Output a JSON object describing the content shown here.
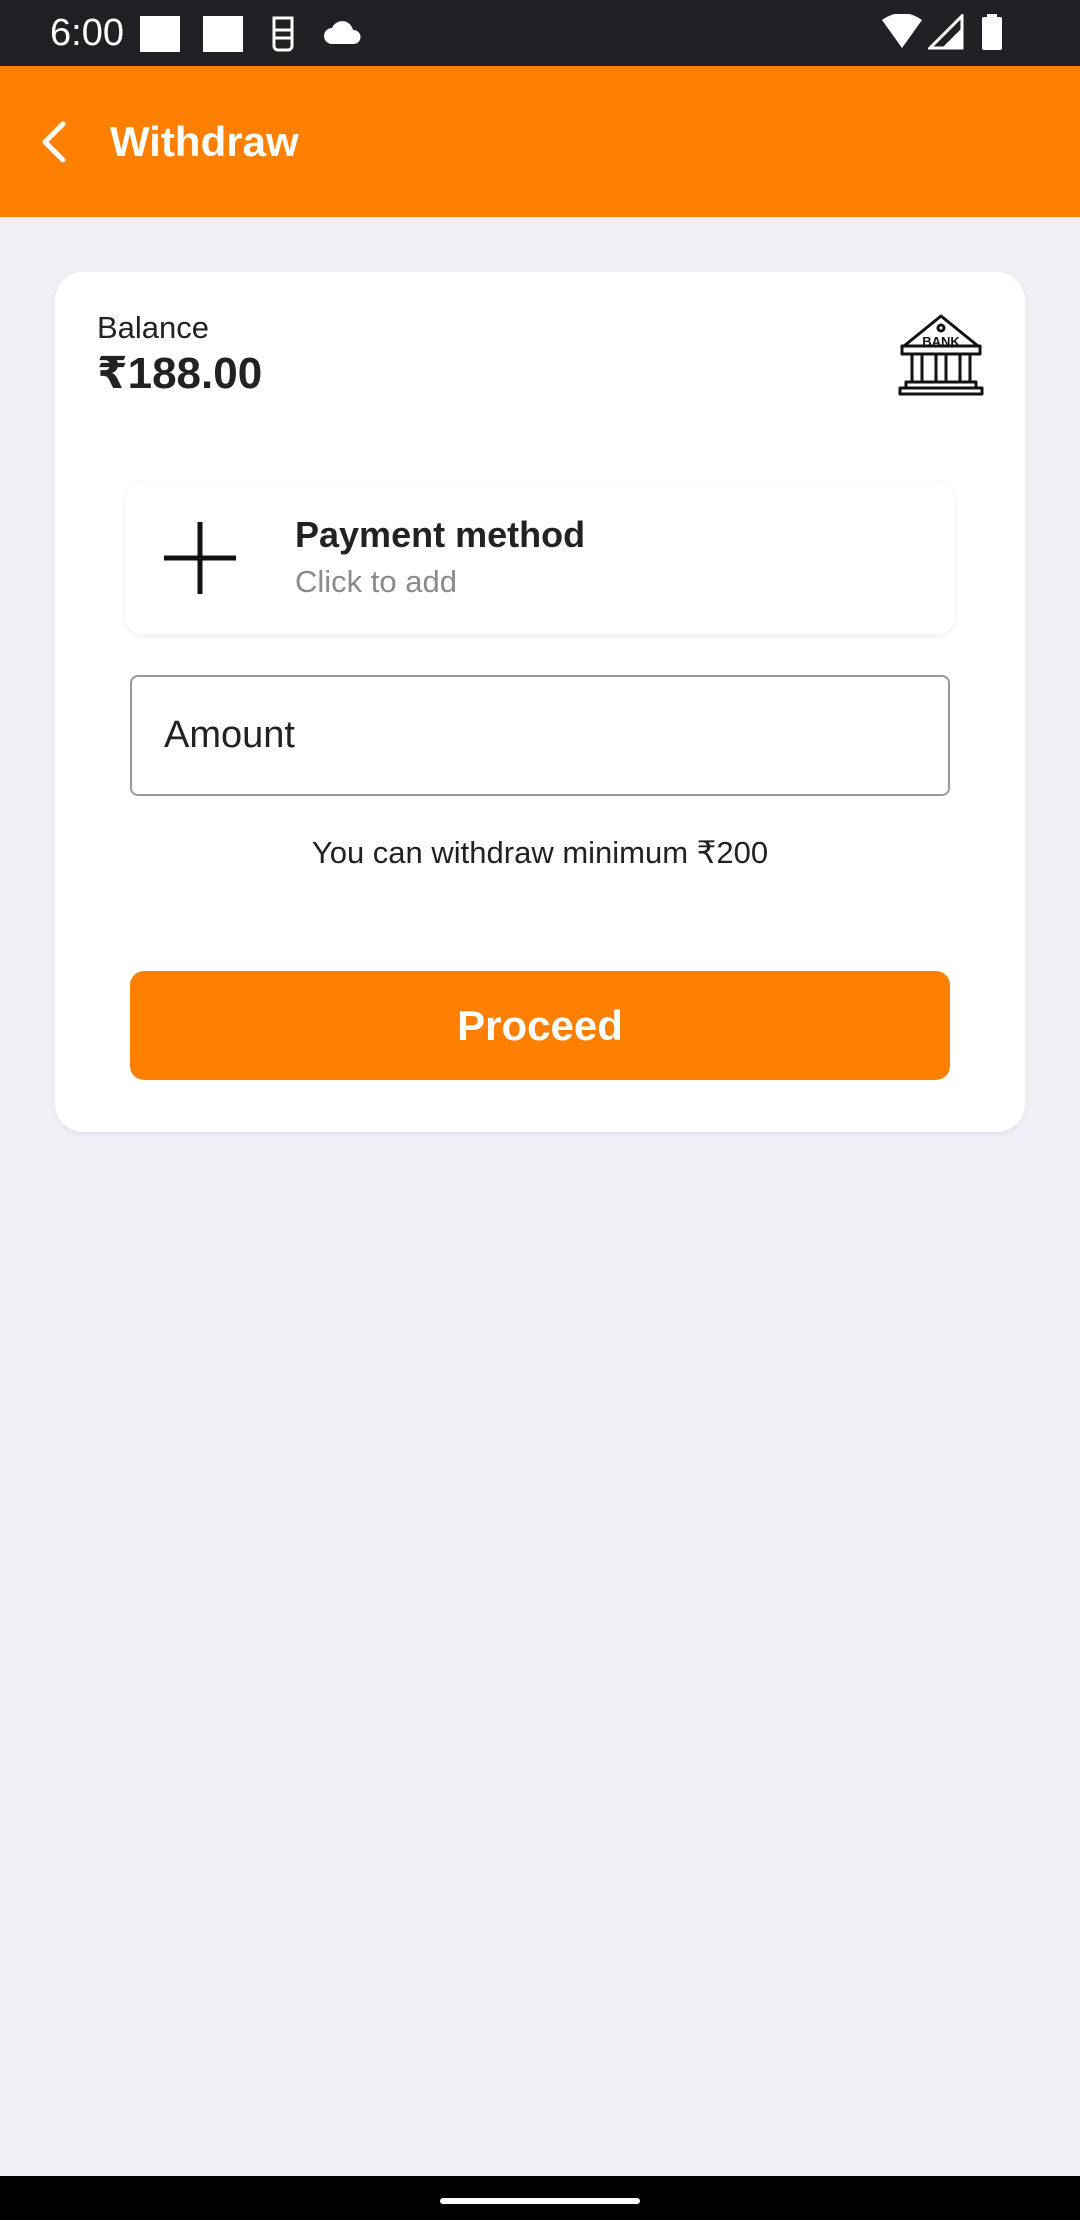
{
  "status_bar": {
    "time": "6:00",
    "icons": [
      "notification-square-icon",
      "notification-square-icon",
      "sim-icon",
      "cloud-icon",
      "wifi-icon",
      "signal-icon",
      "battery-icon"
    ]
  },
  "app_bar": {
    "title": "Withdraw",
    "back_icon": "chevron-left-icon",
    "color": "#ff8000"
  },
  "balance": {
    "label": "Balance",
    "amount": "₹188.00",
    "icon": "bank-icon"
  },
  "payment_method": {
    "title": "Payment method",
    "subtitle": "Click to add",
    "icon": "plus-icon"
  },
  "amount_input": {
    "placeholder": "Amount",
    "value": ""
  },
  "hint": "You can withdraw minimum ₹200",
  "proceed_label": "Proceed",
  "colors": {
    "accent": "#ff8000",
    "background": "#eff0f6"
  }
}
